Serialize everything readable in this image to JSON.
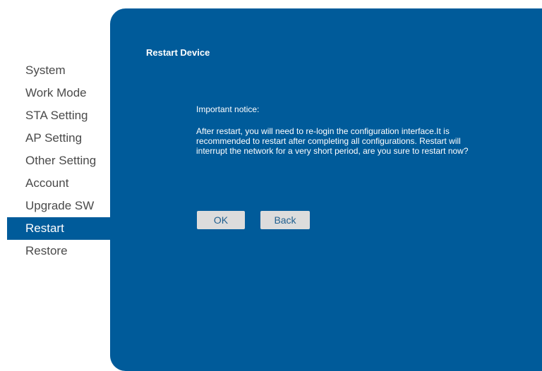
{
  "sidebar": {
    "items": [
      {
        "label": "System"
      },
      {
        "label": "Work Mode"
      },
      {
        "label": "STA Setting"
      },
      {
        "label": "AP Setting"
      },
      {
        "label": "Other Setting"
      },
      {
        "label": "Account"
      },
      {
        "label": "Upgrade SW"
      },
      {
        "label": "Restart",
        "active": true
      },
      {
        "label": "Restore"
      }
    ]
  },
  "main": {
    "title": "Restart Device",
    "notice_heading": "Important notice:",
    "notice_body": "After restart, you will need to re-login the configuration interface.It is recommended to restart after completing all configurations. Restart will interrupt the network for a very short period, are you sure to restart now?",
    "ok_label": "OK",
    "back_label": "Back"
  },
  "colors": {
    "panel_background": "#005b9a",
    "active_item_background": "#005b9a",
    "sidebar_text": "#4a4a4a",
    "button_background": "#dcdcdc",
    "button_text": "#1f5f8f"
  }
}
